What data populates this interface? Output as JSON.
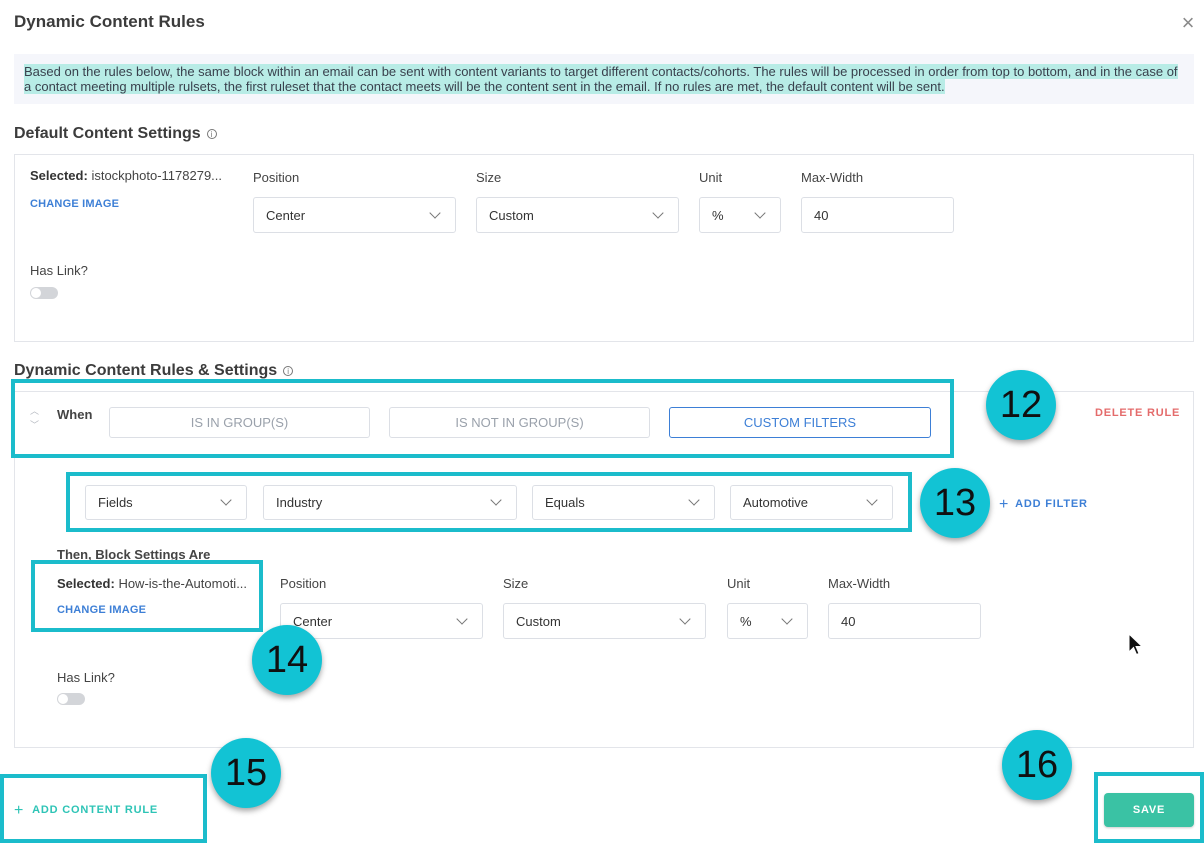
{
  "modal": {
    "title": "Dynamic Content Rules",
    "close_icon": "close-icon",
    "description": "Based on the rules below, the same block within an email can be sent with content variants to target different contacts/cohorts. The rules will be processed in order from top to bottom, and in the case of a contact meeting multiple rulsets, the first ruleset that the contact meets will be the content sent in the email. If no rules are met, the default content will be sent."
  },
  "default_settings": {
    "title": "Default Content Settings",
    "selected_label": "Selected:",
    "selected_value": "istockphoto-1178279...",
    "change_image": "CHANGE IMAGE",
    "position_label": "Position",
    "position_value": "Center",
    "size_label": "Size",
    "size_value": "Custom",
    "unit_label": "Unit",
    "unit_value": "%",
    "maxwidth_label": "Max-Width",
    "maxwidth_value": "40",
    "has_link_label": "Has Link?",
    "has_link": false
  },
  "rules": {
    "title": "Dynamic Content Rules & Settings",
    "when_label": "When",
    "segments": [
      "IS IN GROUP(S)",
      "IS NOT IN GROUP(S)",
      "CUSTOM FILTERS"
    ],
    "active_segment": "CUSTOM FILTERS",
    "delete_rule": "DELETE RULE",
    "filter": {
      "field_type": "Fields",
      "field": "Industry",
      "operator": "Equals",
      "value": "Automotive"
    },
    "add_filter": "ADD FILTER",
    "then_label": "Then, Block Settings Are",
    "selected_label": "Selected:",
    "selected_value": "How-is-the-Automoti...",
    "change_image": "CHANGE IMAGE",
    "position_label": "Position",
    "position_value": "Center",
    "size_label": "Size",
    "size_value": "Custom",
    "unit_label": "Unit",
    "unit_value": "%",
    "maxwidth_label": "Max-Width",
    "maxwidth_value": "40",
    "has_link_label": "Has Link?",
    "has_link": false
  },
  "footer": {
    "add_content_rule": "ADD CONTENT RULE",
    "save": "SAVE"
  },
  "annotations": [
    "12",
    "13",
    "14",
    "15",
    "16"
  ],
  "colors": {
    "highlight": "#1bbccb",
    "badge": "#12c3d4",
    "link_blue": "#3d7fd6",
    "delete_red": "#e46b6b",
    "save_green": "#3ac2a4"
  }
}
